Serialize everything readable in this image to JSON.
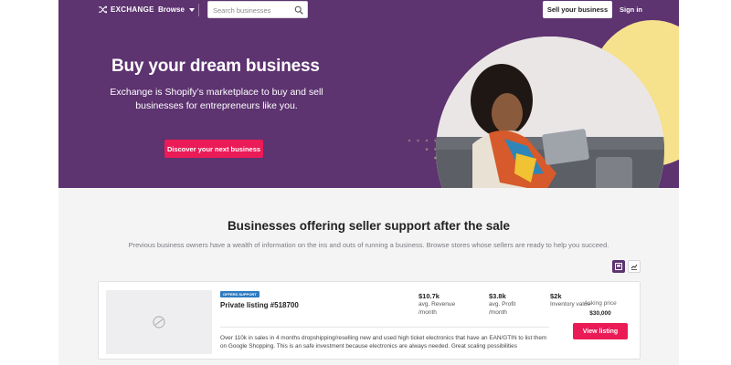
{
  "header": {
    "brand": "EXCHANGE",
    "browse_label": "Browse",
    "search_placeholder": "Search businesses",
    "sell_label": "Sell your business",
    "signin_label": "Sign in"
  },
  "hero": {
    "title": "Buy your dream business",
    "subtitle": "Exchange is Shopify’s marketplace to buy and sell businesses for entrepreneurs like you.",
    "cta_label": "Discover your next business"
  },
  "section": {
    "title": "Businesses offering seller support after the sale",
    "subtitle": "Previous business owners have a wealth of information on the ins and outs of running a business. Browse stores whose sellers are ready to help you succeed."
  },
  "listing": {
    "badge": "OFFERS SUPPORT",
    "title": "Private listing #518700",
    "revenue_value": "$10.7k",
    "revenue_label": "avg. Revenue",
    "revenue_period": "/month",
    "profit_value": "$3.8k",
    "profit_label": "avg. Profit",
    "profit_period": "/month",
    "inventory_value": "$2k",
    "inventory_label": "Inventory value",
    "description": "Over 110k in sales in 4 months dropshipping/reselling new and used high ticket electronics that have an EAN/GTIN to list them on Google Shopping. This is an safe investment because electronics are always needed. Great scaling possibilities",
    "asking_label": "Asking price",
    "asking_value": "$30,000",
    "view_label": "View listing"
  },
  "colors": {
    "hero_bg": "#5d3370",
    "accent_pink": "#ea1b57",
    "accent_yellow": "#f6e18d",
    "badge_blue": "#2f7bbf"
  },
  "icons": [
    "shuffle-icon",
    "chevron-down-icon",
    "search-icon",
    "grid-view-icon",
    "list-view-icon",
    "image-placeholder-icon"
  ]
}
